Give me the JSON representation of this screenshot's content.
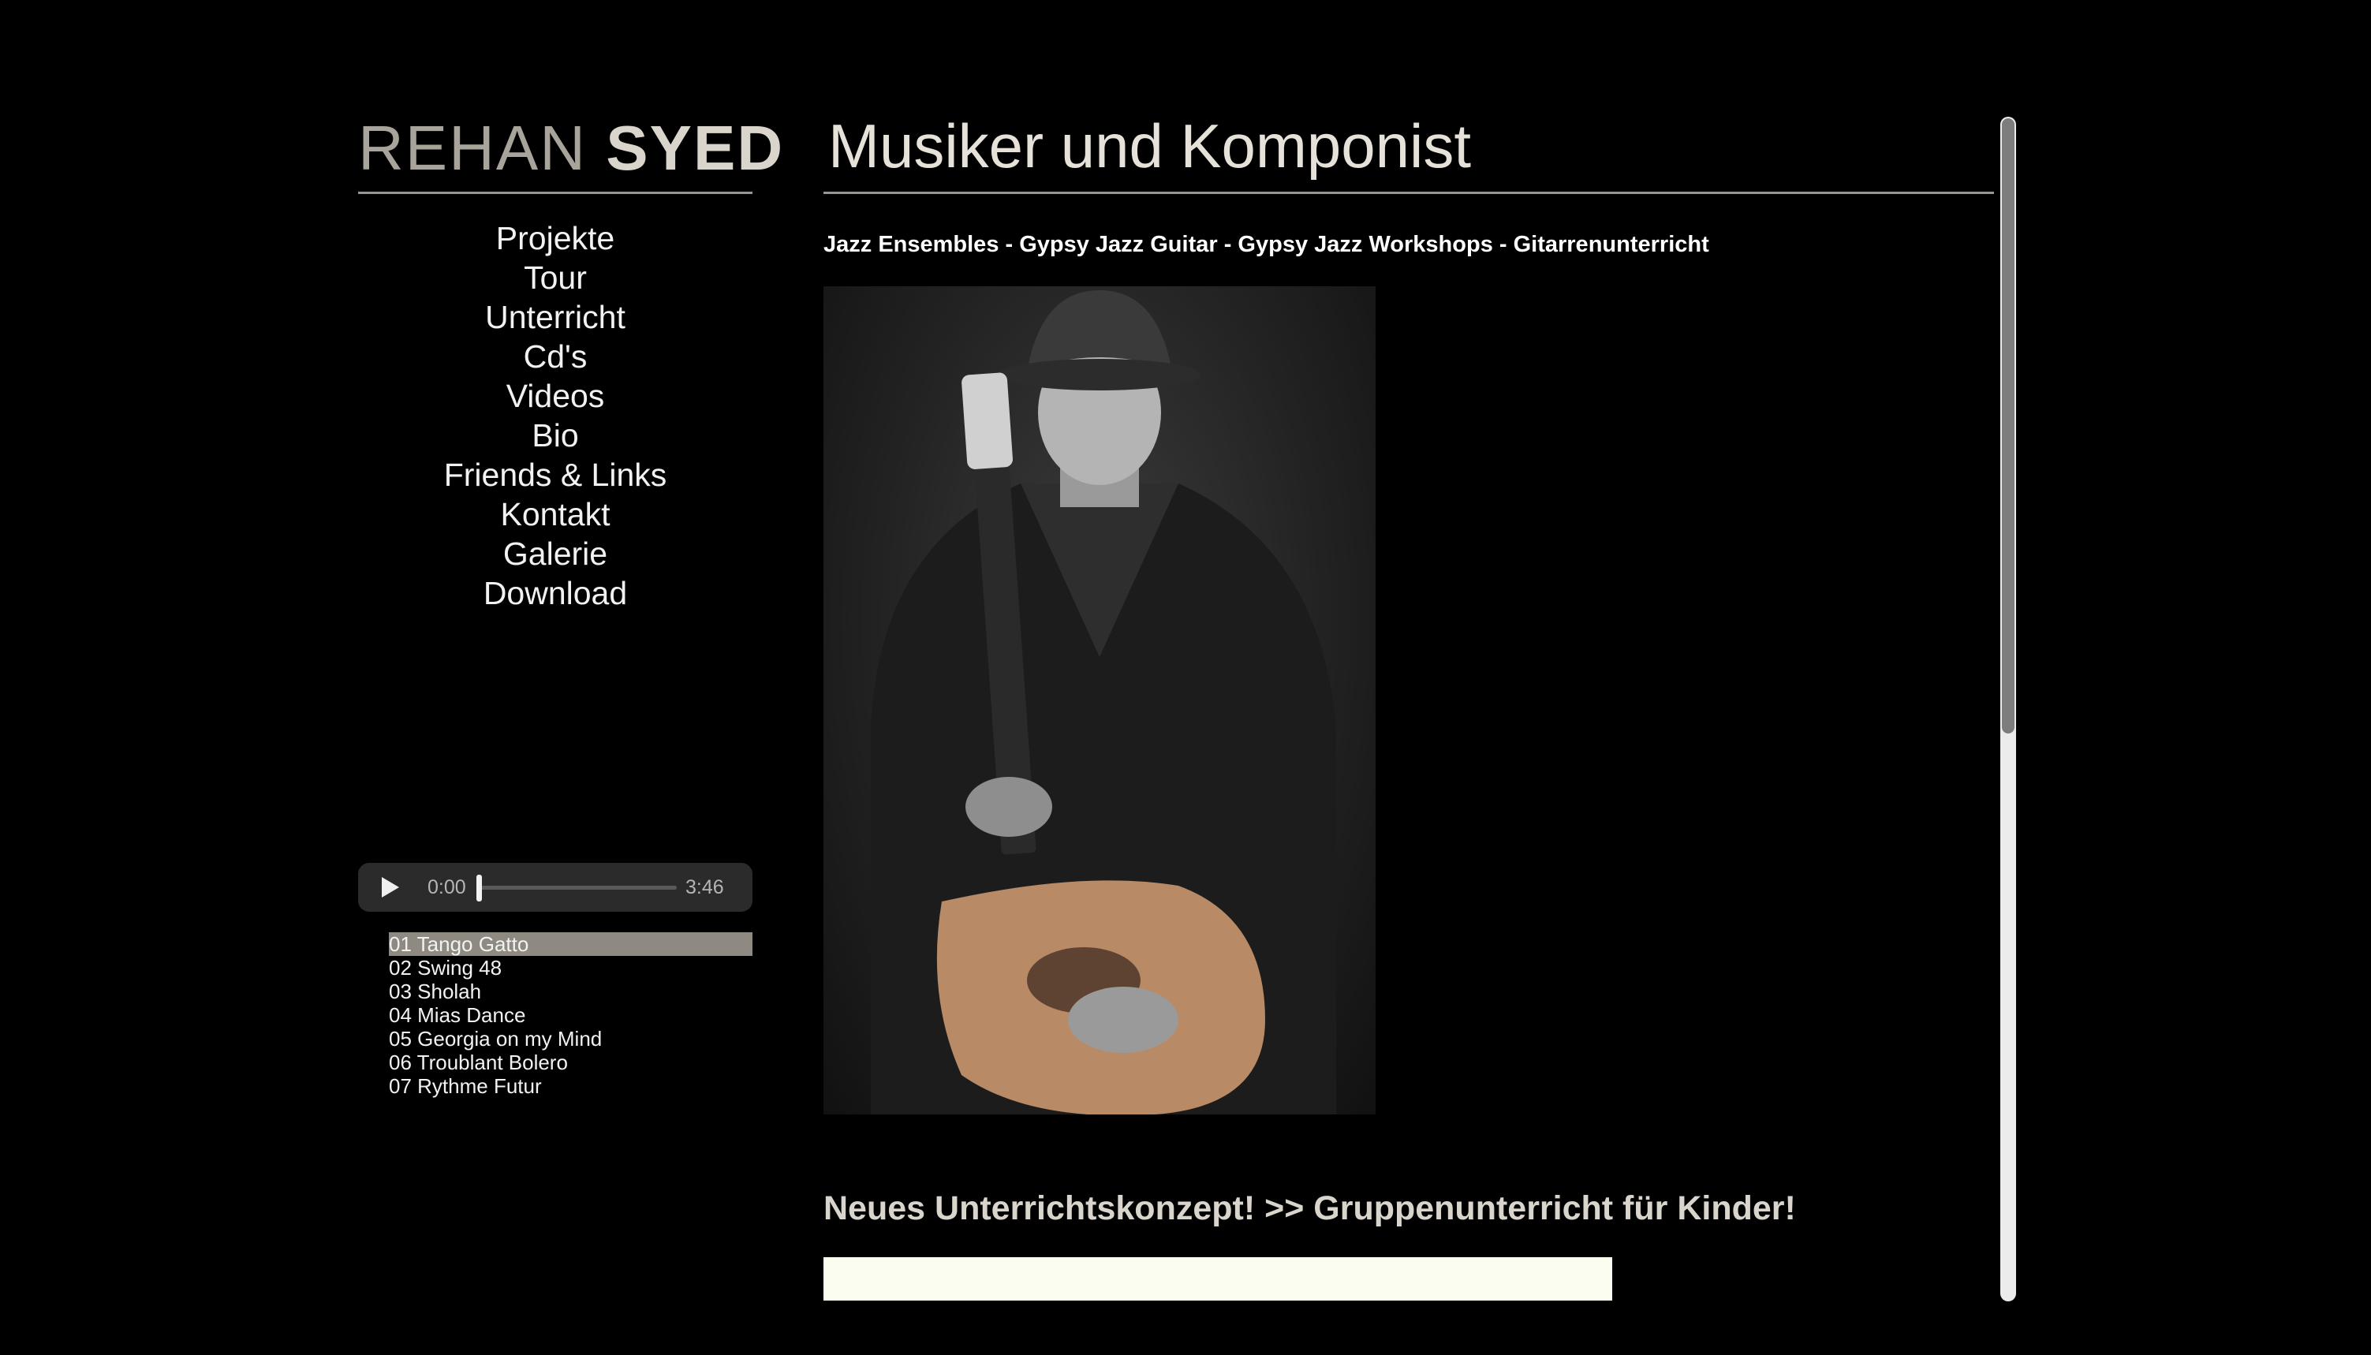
{
  "sidebar": {
    "logo_first": "REHAN",
    "logo_last": "SYED",
    "nav": [
      "Projekte",
      "Tour",
      "Unterricht",
      "Cd's",
      "Videos",
      "Bio",
      "Friends & Links",
      "Kontakt",
      "Galerie",
      "Download"
    ]
  },
  "player": {
    "current_time": "0:00",
    "duration": "3:46",
    "progress": 0,
    "play_icon": "play-icon"
  },
  "playlist": {
    "active_index": 0,
    "tracks": [
      "01 Tango Gatto",
      "02 Swing 48",
      "03 Sholah",
      "04 Mias Dance",
      "05 Georgia on my Mind",
      "06 Troublant Bolero",
      "07 Rythme Futur"
    ]
  },
  "main": {
    "title": "Musiker und Komponist",
    "subtitle": "Jazz Ensembles - Gypsy Jazz Guitar - Gypsy Jazz Workshops - Gitarrenunterricht",
    "headline": "Neues Unterrichtskonzept! >> Gruppenunterricht für Kinder!"
  },
  "colors": {
    "background": "#000000",
    "logo_light": "#a8a49b",
    "logo_bold": "#d9d5cc",
    "rule": "#9a968e",
    "playlist_active": "#8e8a82",
    "cream_bar": "#fbfdf1"
  }
}
